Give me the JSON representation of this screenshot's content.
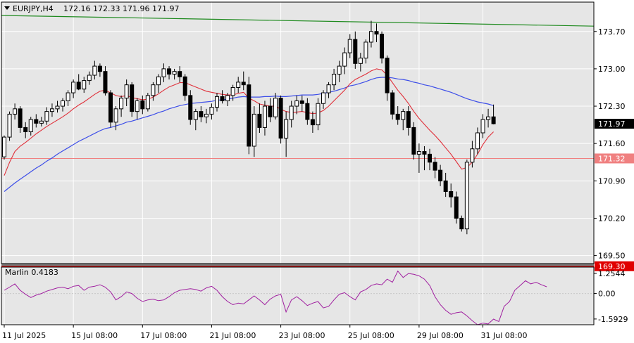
{
  "header": {
    "symbol": "EURJPY,H4",
    "ohlc": "172.16 172.33 171.96 171.97"
  },
  "colors": {
    "background": "#ffffff",
    "plot_bg": "#e6e6e6",
    "grid": "#ffffff",
    "bull_body": "#ffffff",
    "bear_body": "#000000",
    "wick": "#000000",
    "ma_fast": "#e0303a",
    "ma_slow": "#3d4ee8",
    "ma_long": "#1e8a1e",
    "hline_mid": "#f08080",
    "hline_low": "#e00000",
    "marlin": "#a020a0",
    "price_tag_bg": "#000000",
    "hline_tag_bg": "#f08080",
    "low_tag_bg": "#e00000"
  },
  "chart_data": [
    {
      "type": "candlestick",
      "title": "EURJPY,H4",
      "price_axis_labels": [
        "173.70",
        "173.00",
        "172.30",
        "171.60",
        "170.90",
        "170.20",
        "169.50"
      ],
      "time_axis_labels": [
        "11 Jul 2025",
        "15 Jul 08:00",
        "17 Jul 08:00",
        "21 Jul 08:00",
        "23 Jul 08:00",
        "25 Jul 08:00",
        "29 Jul 08:00",
        "31 Jul 08:00"
      ],
      "ylim": [
        169.35,
        174.25
      ],
      "grid": true,
      "current_price": "171.97",
      "horizontal_levels": [
        {
          "value": 171.32,
          "label": "171.32"
        },
        {
          "value": 169.3,
          "label": "169.30"
        }
      ],
      "candles": [
        [
          171.35,
          171.75,
          171.3,
          171.72
        ],
        [
          171.72,
          172.2,
          171.65,
          172.15
        ],
        [
          172.15,
          172.35,
          172.05,
          172.25
        ],
        [
          172.25,
          172.3,
          171.8,
          171.9
        ],
        [
          171.9,
          172.0,
          171.7,
          171.82
        ],
        [
          171.82,
          172.1,
          171.75,
          172.05
        ],
        [
          172.05,
          172.15,
          171.9,
          171.98
        ],
        [
          171.98,
          172.1,
          171.92,
          172.02
        ],
        [
          172.02,
          172.28,
          171.95,
          172.2
        ],
        [
          172.2,
          172.35,
          172.1,
          172.25
        ],
        [
          172.25,
          172.4,
          172.18,
          172.3
        ],
        [
          172.3,
          172.45,
          172.2,
          172.4
        ],
        [
          172.4,
          172.6,
          172.3,
          172.55
        ],
        [
          172.55,
          172.8,
          172.45,
          172.75
        ],
        [
          172.75,
          172.9,
          172.6,
          172.62
        ],
        [
          172.62,
          172.85,
          172.55,
          172.78
        ],
        [
          172.78,
          172.95,
          172.7,
          172.88
        ],
        [
          172.88,
          173.15,
          172.8,
          173.05
        ],
        [
          173.05,
          173.1,
          172.85,
          172.95
        ],
        [
          172.95,
          173.05,
          172.5,
          172.55
        ],
        [
          172.55,
          172.6,
          171.9,
          172.0
        ],
        [
          172.0,
          172.3,
          171.85,
          172.25
        ],
        [
          172.25,
          172.5,
          172.1,
          172.45
        ],
        [
          172.45,
          172.8,
          172.3,
          172.7
        ],
        [
          172.7,
          172.75,
          172.1,
          172.2
        ],
        [
          172.2,
          172.45,
          172.05,
          172.4
        ],
        [
          172.4,
          172.5,
          172.15,
          172.25
        ],
        [
          172.25,
          172.55,
          172.2,
          172.5
        ],
        [
          172.5,
          172.75,
          172.4,
          172.7
        ],
        [
          172.7,
          172.9,
          172.55,
          172.85
        ],
        [
          172.85,
          173.1,
          172.75,
          173.0
        ],
        [
          173.0,
          173.05,
          172.8,
          172.9
        ],
        [
          172.9,
          173.0,
          172.8,
          172.95
        ],
        [
          172.95,
          173.05,
          172.75,
          172.85
        ],
        [
          172.85,
          172.9,
          172.4,
          172.5
        ],
        [
          172.5,
          172.6,
          171.95,
          172.05
        ],
        [
          172.05,
          172.25,
          171.85,
          172.2
        ],
        [
          172.2,
          172.3,
          172.0,
          172.1
        ],
        [
          172.1,
          172.25,
          171.98,
          172.15
        ],
        [
          172.15,
          172.35,
          172.05,
          172.28
        ],
        [
          172.28,
          172.55,
          172.2,
          172.48
        ],
        [
          172.48,
          172.6,
          172.35,
          172.4
        ],
        [
          172.4,
          172.55,
          172.3,
          172.5
        ],
        [
          172.5,
          172.7,
          172.4,
          172.65
        ],
        [
          172.65,
          172.85,
          172.55,
          172.75
        ],
        [
          172.75,
          172.95,
          172.6,
          172.7
        ],
        [
          172.7,
          172.85,
          171.4,
          171.55
        ],
        [
          171.55,
          172.3,
          171.35,
          172.15
        ],
        [
          172.15,
          172.35,
          171.8,
          171.9
        ],
        [
          171.9,
          172.4,
          171.75,
          172.3
        ],
        [
          172.3,
          172.45,
          172.0,
          172.1
        ],
        [
          172.1,
          172.55,
          172.05,
          172.45
        ],
        [
          172.45,
          172.5,
          171.6,
          171.7
        ],
        [
          171.7,
          172.2,
          171.35,
          172.05
        ],
        [
          172.05,
          172.4,
          171.9,
          172.3
        ],
        [
          172.3,
          172.5,
          172.15,
          172.4
        ],
        [
          172.4,
          172.5,
          172.2,
          172.35
        ],
        [
          172.35,
          172.45,
          171.95,
          172.05
        ],
        [
          172.05,
          172.2,
          171.8,
          171.95
        ],
        [
          171.95,
          172.45,
          171.85,
          172.35
        ],
        [
          172.35,
          172.6,
          172.25,
          172.55
        ],
        [
          172.55,
          172.75,
          172.45,
          172.7
        ],
        [
          172.7,
          173.0,
          172.6,
          172.9
        ],
        [
          172.9,
          173.15,
          172.75,
          173.05
        ],
        [
          173.05,
          173.4,
          172.9,
          173.3
        ],
        [
          173.3,
          173.65,
          173.2,
          173.55
        ],
        [
          173.55,
          173.7,
          173.0,
          173.1
        ],
        [
          173.1,
          173.3,
          172.95,
          173.2
        ],
        [
          173.2,
          173.55,
          173.1,
          173.5
        ],
        [
          173.5,
          173.9,
          173.4,
          173.7
        ],
        [
          173.7,
          173.85,
          173.5,
          173.65
        ],
        [
          173.65,
          173.7,
          173.1,
          173.2
        ],
        [
          173.2,
          173.25,
          172.4,
          172.55
        ],
        [
          172.55,
          172.6,
          172.05,
          172.15
        ],
        [
          172.15,
          172.3,
          171.95,
          172.05
        ],
        [
          172.05,
          172.25,
          171.85,
          172.2
        ],
        [
          172.2,
          172.3,
          171.75,
          171.9
        ],
        [
          171.9,
          172.0,
          171.3,
          171.4
        ],
        [
          171.4,
          171.6,
          171.05,
          171.45
        ],
        [
          171.45,
          171.55,
          171.1,
          171.4
        ],
        [
          171.4,
          171.5,
          171.1,
          171.25
        ],
        [
          171.25,
          171.35,
          170.95,
          171.1
        ],
        [
          171.1,
          171.2,
          170.8,
          170.9
        ],
        [
          170.9,
          171.05,
          170.6,
          170.7
        ],
        [
          170.7,
          170.85,
          170.4,
          170.6
        ],
        [
          170.6,
          170.7,
          170.1,
          170.2
        ],
        [
          170.2,
          170.25,
          169.95,
          170.0
        ],
        [
          170.0,
          171.3,
          169.9,
          171.25
        ],
        [
          171.25,
          171.65,
          171.15,
          171.5
        ],
        [
          171.5,
          171.9,
          171.4,
          171.8
        ],
        [
          171.8,
          172.15,
          171.7,
          172.05
        ],
        [
          172.05,
          172.25,
          171.9,
          172.1
        ],
        [
          172.1,
          172.33,
          171.96,
          171.97
        ]
      ],
      "ma_fast_values": [
        171.0,
        171.25,
        171.45,
        171.55,
        171.62,
        171.7,
        171.78,
        171.85,
        171.92,
        171.98,
        172.04,
        172.1,
        172.17,
        172.25,
        172.32,
        172.38,
        172.45,
        172.52,
        172.58,
        172.6,
        172.55,
        172.5,
        172.48,
        172.5,
        172.46,
        172.44,
        172.42,
        172.43,
        172.47,
        172.53,
        172.6,
        172.66,
        172.7,
        172.74,
        172.74,
        172.7,
        172.66,
        172.62,
        172.58,
        172.56,
        172.54,
        172.52,
        172.51,
        172.51,
        172.54,
        172.56,
        172.45,
        172.4,
        172.34,
        172.32,
        172.3,
        172.3,
        172.24,
        172.2,
        172.18,
        172.19,
        172.2,
        172.18,
        172.16,
        172.17,
        172.22,
        172.3,
        172.4,
        172.5,
        172.6,
        172.72,
        172.8,
        172.85,
        172.9,
        172.96,
        173.0,
        172.98,
        172.88,
        172.74,
        172.6,
        172.48,
        172.35,
        172.2,
        172.07,
        171.96,
        171.85,
        171.75,
        171.64,
        171.52,
        171.4,
        171.26,
        171.12,
        171.15,
        171.25,
        171.4,
        171.58,
        171.72,
        171.82
      ],
      "ma_slow_values": [
        170.7,
        170.78,
        170.86,
        170.93,
        171.0,
        171.07,
        171.14,
        171.2,
        171.27,
        171.33,
        171.4,
        171.46,
        171.52,
        171.58,
        171.64,
        171.69,
        171.74,
        171.79,
        171.84,
        171.88,
        171.9,
        171.93,
        171.96,
        172.0,
        172.02,
        172.05,
        172.08,
        172.11,
        172.14,
        172.18,
        172.21,
        172.25,
        172.28,
        172.31,
        172.33,
        172.35,
        172.36,
        172.37,
        172.38,
        172.39,
        172.41,
        172.42,
        172.43,
        172.45,
        172.47,
        172.48,
        172.47,
        172.47,
        172.47,
        172.48,
        172.48,
        172.49,
        172.48,
        172.48,
        172.49,
        172.5,
        172.51,
        172.51,
        172.51,
        172.52,
        172.54,
        172.56,
        172.58,
        172.61,
        172.64,
        172.68,
        172.7,
        172.73,
        172.76,
        172.8,
        172.83,
        172.84,
        172.84,
        172.83,
        172.81,
        172.8,
        172.78,
        172.75,
        172.73,
        172.7,
        172.68,
        172.65,
        172.62,
        172.59,
        172.56,
        172.52,
        172.48,
        172.44,
        172.41,
        172.38,
        172.36,
        172.34,
        172.31
      ],
      "ma_long_start": 174.0,
      "ma_long_end": 173.8
    },
    {
      "type": "line",
      "title": "Marlin 0.4183",
      "tick_labels": [
        "1.2544",
        "0.00",
        "-1.5929"
      ],
      "ylim": [
        -1.95,
        1.65
      ],
      "values": [
        0.2,
        0.4,
        0.6,
        0.2,
        -0.05,
        -0.25,
        -0.1,
        0.0,
        0.15,
        0.25,
        0.35,
        0.4,
        0.3,
        0.45,
        0.5,
        0.2,
        0.4,
        0.45,
        0.55,
        0.4,
        0.1,
        -0.4,
        -0.2,
        0.1,
        0.0,
        -0.3,
        -0.5,
        -0.4,
        -0.35,
        -0.45,
        -0.4,
        -0.2,
        0.05,
        0.2,
        0.25,
        0.3,
        0.25,
        0.15,
        0.35,
        0.45,
        0.2,
        -0.2,
        -0.5,
        -0.7,
        -0.6,
        -0.65,
        -0.4,
        -0.15,
        -0.4,
        -0.7,
        -0.35,
        -0.15,
        -0.05,
        -1.15,
        -0.4,
        -0.2,
        -0.45,
        -0.75,
        -0.6,
        -0.5,
        -0.9,
        -0.8,
        -0.4,
        -0.05,
        0.05,
        -0.2,
        -0.4,
        0.1,
        0.25,
        0.5,
        0.6,
        0.55,
        0.9,
        0.7,
        1.4,
        1.0,
        1.25,
        1.2,
        1.1,
        0.9,
        0.5,
        -0.2,
        -0.7,
        -1.05,
        -1.3,
        -1.2,
        -1.15,
        -1.4,
        -1.7,
        -1.95,
        -1.85,
        -1.9,
        -1.6,
        -1.75,
        -0.8,
        -0.5,
        0.2,
        0.5,
        0.8,
        0.6,
        0.7,
        0.55,
        0.42
      ]
    }
  ]
}
